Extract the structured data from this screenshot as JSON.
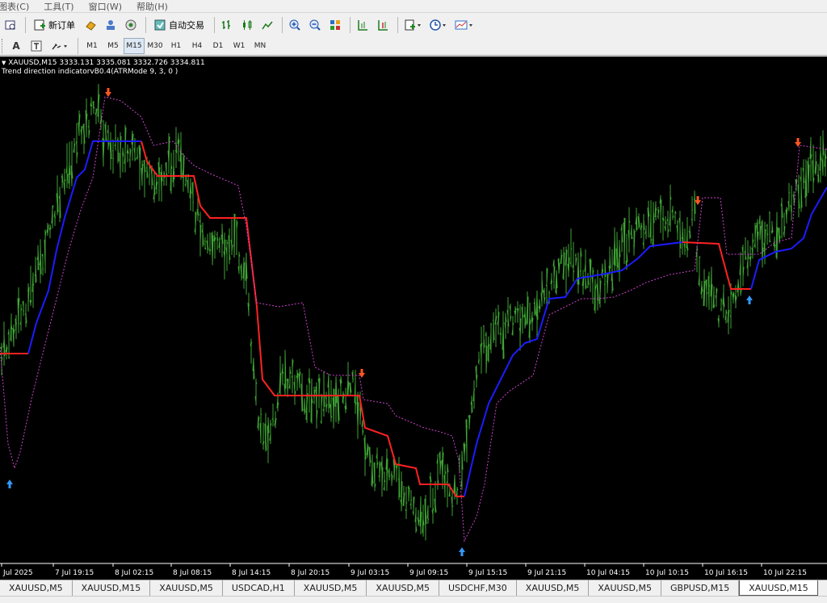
{
  "menu": [
    "图表(C)",
    "工具(T)",
    "窗口(W)",
    "帮助(H)"
  ],
  "toolbar": {
    "new_order_label": "新订单",
    "auto_trade_label": "自动交易"
  },
  "timeframes": [
    "M1",
    "M5",
    "M15",
    "M30",
    "H1",
    "H4",
    "D1",
    "W1",
    "MN"
  ],
  "active_timeframe": "M15",
  "chart": {
    "title": "XAUUSD,M15  3333.131 3335.081 3332.726 3334.811",
    "indicator": "Trend direction indicatorvB0.4(ATRMode 9, 3, 0 )",
    "colors": {
      "background": "#000000",
      "bars": "#3fa534",
      "trend_up": "#1c1cff",
      "trend_down": "#ff2222",
      "stop_line": "#cc44cc",
      "arrow_up": "#3399ff",
      "arrow_down": "#ff5522",
      "axis": "#ffffff"
    }
  },
  "chart_data": {
    "type": "line",
    "title": "XAUUSD,M15  3333.131 3335.081 3332.726 3334.811",
    "symbol": "XAUUSD",
    "timeframe": "M15",
    "ohlc_last": {
      "open": 3333.131,
      "high": 3335.081,
      "low": 3332.726,
      "close": 3334.811
    },
    "x_ticks": [
      "Jul 2025",
      "7 Jul 19:15",
      "8 Jul 02:15",
      "8 Jul 08:15",
      "8 Jul 14:15",
      "8 Jul 20:15",
      "9 Jul 03:15",
      "9 Jul 09:15",
      "9 Jul 15:15",
      "9 Jul 21:15",
      "10 Jul 04:15",
      "10 Jul 10:15",
      "10 Jul 16:15",
      "10 Jul 22:15"
    ],
    "series": [
      {
        "name": "Trend direction indicatorvB0.4"
      }
    ]
  },
  "tabs": [
    "XAUUSD,M5",
    "XAUUSD,M15",
    "XAUUSD,M5",
    "USDCAD,H1",
    "XAUUSD,M5",
    "XAUUSD,M5",
    "USDCHF,M30",
    "XAUUSD,M5",
    "XAUUSD,M5",
    "GBPUSD,M15",
    "XAUUSD,M15"
  ],
  "active_tab": 10
}
